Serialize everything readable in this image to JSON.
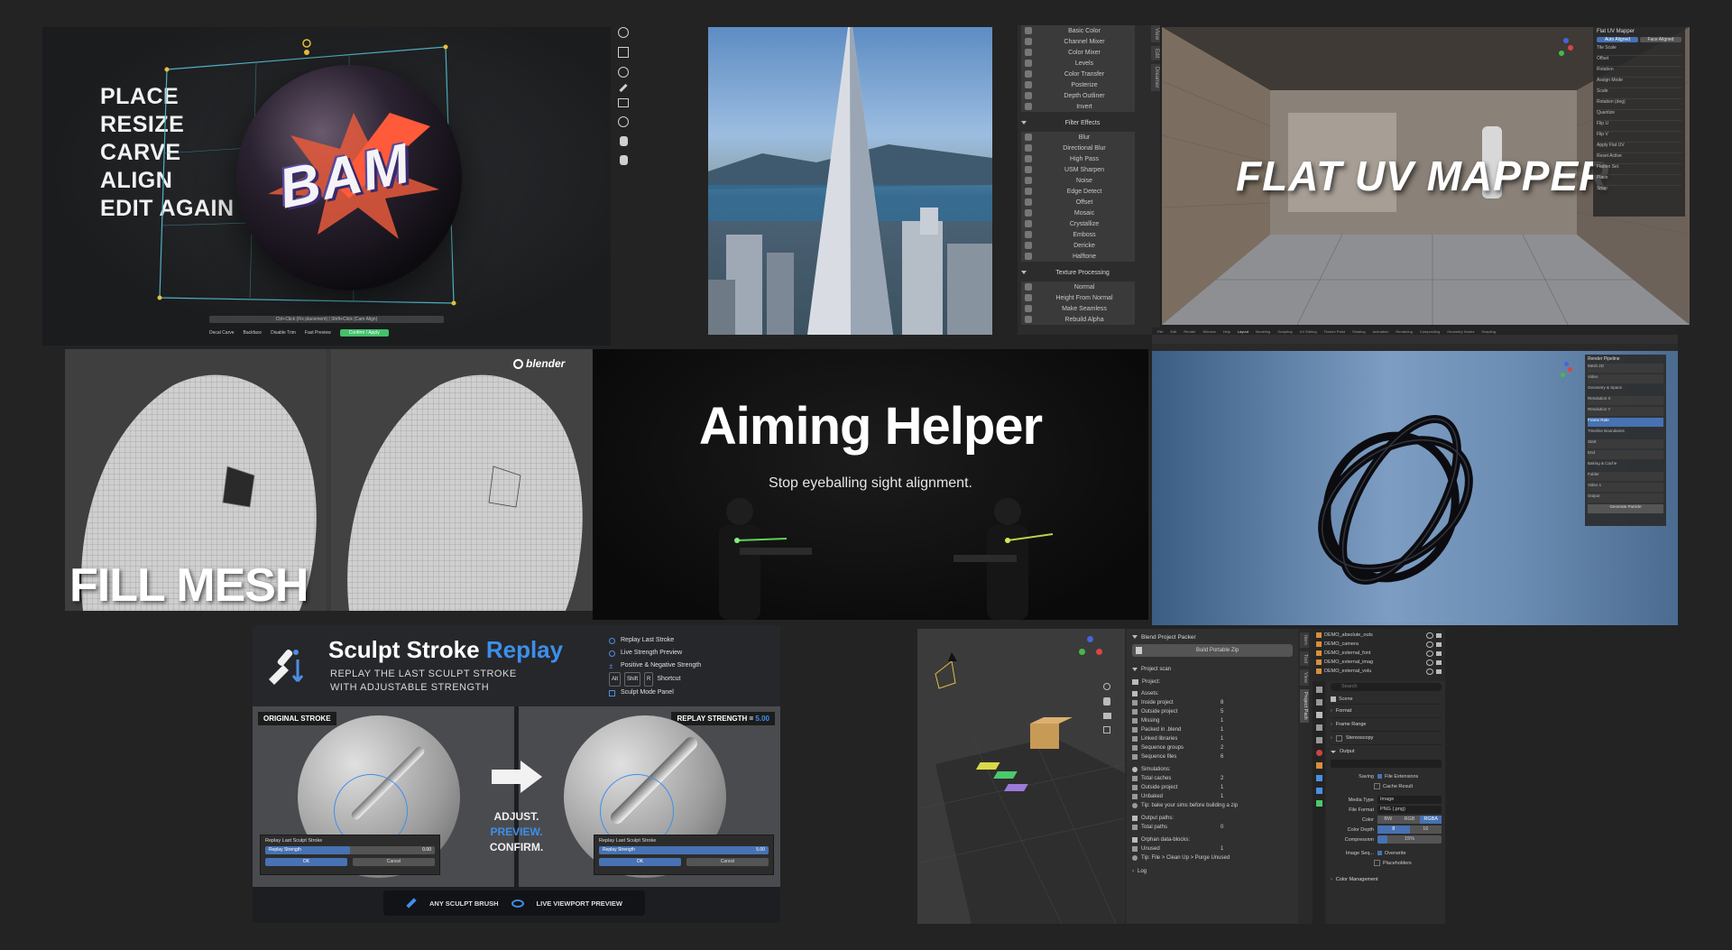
{
  "tiles": {
    "bam": {
      "steps": [
        "PLACE",
        "RESIZE",
        "CARVE",
        "ALIGN",
        "EDIT AGAIN"
      ],
      "word": "BAM",
      "hint": "Ctrl+Click (Fix placement) | Shift+Click (Cam Align)",
      "options": [
        "Decal Carve",
        "Backface",
        "Disable Trim",
        "Fast Preview"
      ],
      "confirm": "Confirm / Apply"
    },
    "filter": {
      "top_items": [
        "Basic Color",
        "Channel Mixer",
        "Color Mixer",
        "Levels",
        "Color Transfer",
        "Posterize",
        "Depth Outliner",
        "Invert"
      ],
      "filter_header": "Filter Effects",
      "filter_items": [
        "Blur",
        "Directional Blur",
        "High Pass",
        "USM Sharpen",
        "Noise",
        "Edge Detect",
        "Offset",
        "Mosaic",
        "Crystallize",
        "Emboss",
        "Dericke",
        "Halftone"
      ],
      "texture_header": "Texture Processing",
      "texture_items": [
        "Normal",
        "Height From Normal",
        "Make Seamless",
        "Rebuild Alpha"
      ],
      "side_tabs": [
        "View",
        "Edit",
        "Dreamer"
      ]
    },
    "uv": {
      "title": "FLAT UV MAPPER",
      "panel_title": "Flat UV Mapper",
      "panel_tabs": [
        "Auto Aligned",
        "Face Aligned"
      ],
      "panel_rows": [
        "Tile Scale",
        "Offset",
        "Rotation",
        "Assign Mode",
        "Scale",
        "Rotation (deg)",
        "Quantize",
        "Flip U",
        "Flip V",
        "Apply Flat UV",
        "Reset Active",
        "Flatten Sel.",
        "Place",
        "Snap"
      ]
    },
    "fill": {
      "title": "FILL MESH",
      "brand": "blender"
    },
    "aim": {
      "title": "Aiming Helper",
      "subtitle": "Stop eyeballing sight alignment."
    },
    "particles": {
      "menu": [
        "File",
        "Edit",
        "Render",
        "Window",
        "Help",
        "Layout",
        "Modeling",
        "Sculpting",
        "UV Editing",
        "Texture Paint",
        "Shading",
        "Animation",
        "Rendering",
        "Compositing",
        "Geometry Nodes",
        "Scripting"
      ],
      "panel_title": "Render Pipeline",
      "panel_rows": [
        "Mesh 2D",
        "Video",
        "Geometry & Space",
        "Resolution X",
        "Resolution Y",
        "Frame Rate",
        "Timeline Boundaries",
        "Start",
        "End",
        "Baking & Cache",
        "Folder",
        "Video 1",
        "Output",
        "Generate Particle"
      ]
    },
    "sculpt": {
      "title_a": "Sculpt Stroke ",
      "title_b": "Replay",
      "subtitle_1": "REPLAY THE LAST SCULPT STROKE",
      "subtitle_2": "WITH ADJUSTABLE STRENGTH",
      "features": [
        "Replay Last Stroke",
        "Live Strength Preview",
        "Positive & Negative Strength",
        "Shortcut",
        "Sculpt Mode Panel"
      ],
      "keys": [
        "Alt",
        "Shift",
        "R"
      ],
      "original_label": "ORIGINAL STROKE",
      "replay_label": "REPLAY STRENGTH",
      "replay_eq": "=",
      "replay_value": "5.00",
      "panel_title": "Replay Last Sculpt Stroke",
      "field_label": "Replay Strength",
      "left_value": "0.00",
      "right_value": "5.00",
      "ok": "OK",
      "cancel": "Cancel",
      "adjust": "ADJUST.",
      "preview": "PREVIEW.",
      "confirm": "CONFIRM.",
      "bottom_1": "ANY SCULPT BRUSH",
      "bottom_2": "LIVE VIEWPORT PREVIEW"
    },
    "packer": {
      "panel_title": "Blend Project Packer",
      "build": "Build Portable Zip",
      "scan": "Project scan",
      "project": "Project:",
      "assets_header": "Assets:",
      "assets": [
        {
          "k": "Inside project",
          "v": "8"
        },
        {
          "k": "Outside project",
          "v": "5"
        },
        {
          "k": "Missing",
          "v": "1"
        },
        {
          "k": "Packed in .blend",
          "v": "1"
        },
        {
          "k": "Linked libraries",
          "v": "1"
        },
        {
          "k": "Sequence groups",
          "v": "2"
        },
        {
          "k": "Sequence files",
          "v": "6"
        }
      ],
      "sims_header": "Simulations:",
      "sims": [
        {
          "k": "Total caches",
          "v": "2"
        },
        {
          "k": "Outside project",
          "v": "1"
        },
        {
          "k": "Unbaked",
          "v": "1"
        }
      ],
      "tip1": "Tip: bake your sims before building a zip",
      "output_header": "Output paths:",
      "output": [
        {
          "k": "Total paths",
          "v": "0"
        }
      ],
      "orphan_header": "Orphan data-blocks:",
      "orphan": [
        {
          "k": "Unused",
          "v": "1"
        }
      ],
      "tip2": "Tip: File > Clean Up > Purge Unused",
      "log": "Log",
      "side_tabs": [
        "Item",
        "Tool",
        "View",
        "Project Pack"
      ],
      "outliner": [
        "DEMO_absolute_outs",
        "DEMO_camera",
        "DEMO_external_font",
        "DEMO_external_imag",
        "DEMO_external_volu"
      ],
      "search_placeholder": "Search",
      "scene": "Scene",
      "sections": [
        "Format",
        "Frame Range",
        "Stereoscopy",
        "Output"
      ],
      "saving": "Saving",
      "file_ext": "File Extensions",
      "cache_result": "Cache Result",
      "media_type_label": "Media Type",
      "media_type": "Image",
      "file_format_label": "File Format",
      "file_format": "PNG (.png)",
      "color_label": "Color",
      "color_opts": [
        "BW",
        "RGB",
        "RGBA"
      ],
      "depth_label": "Color Depth",
      "depth_opts": [
        "8",
        "16"
      ],
      "compression_label": "Compression",
      "compression": "15%",
      "image_seq": "Image Seq...",
      "overwrite": "Overwrite",
      "placeholders": "Placeholders",
      "color_mgmt": "Color Management"
    }
  }
}
